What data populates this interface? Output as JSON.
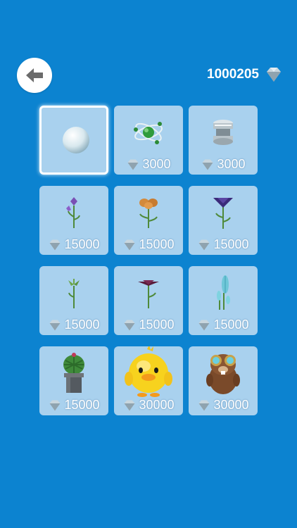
{
  "header": {
    "back_icon": "arrow-left-icon",
    "gems": "1000205",
    "gem_icon": "diamond-icon"
  },
  "colors": {
    "background": "#0c83d0",
    "card": "#a9d1ee",
    "selected_border": "#ffffff"
  },
  "items": [
    {
      "name": "ball",
      "price": "",
      "selected": true
    },
    {
      "name": "atom-orb",
      "price": "3000"
    },
    {
      "name": "metal-capsule",
      "price": "3000"
    },
    {
      "name": "purple-flower",
      "price": "15000"
    },
    {
      "name": "orange-flower",
      "price": "15000"
    },
    {
      "name": "violet-bell-flower",
      "price": "15000"
    },
    {
      "name": "green-sprout",
      "price": "15000"
    },
    {
      "name": "dark-red-flower",
      "price": "15000"
    },
    {
      "name": "blue-feather-plant",
      "price": "15000"
    },
    {
      "name": "potted-cactus",
      "price": "15000"
    },
    {
      "name": "yellow-duck",
      "price": "30000"
    },
    {
      "name": "beaver-with-goggles",
      "price": "30000"
    }
  ]
}
